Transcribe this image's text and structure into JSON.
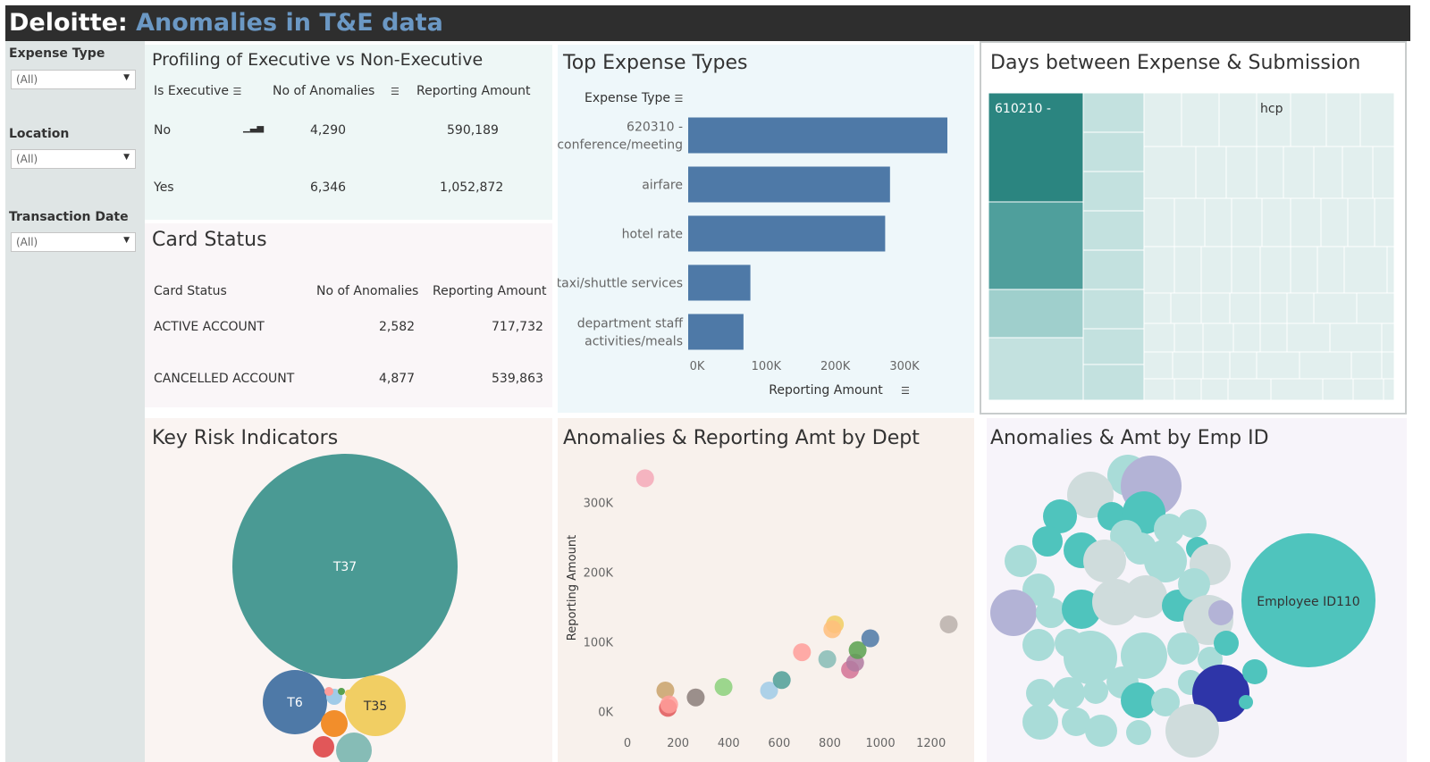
{
  "header": {
    "brand": "Deloitte:",
    "title": "Anomalies in T&E data"
  },
  "filters": [
    {
      "label": "Expense Type",
      "value": "(All)"
    },
    {
      "label": "Location",
      "value": "(All)"
    },
    {
      "label": "Transaction Date",
      "value": "(All)"
    }
  ],
  "profiling": {
    "title": "Profiling of Executive vs Non-Executive",
    "headers": [
      "Is Executive",
      "No of Anomalies",
      "Reporting Amount"
    ],
    "rows": [
      {
        "label": "No",
        "anomalies": "4,290",
        "amount": "590,189"
      },
      {
        "label": "Yes",
        "anomalies": "6,346",
        "amount": "1,052,872"
      }
    ]
  },
  "card_status": {
    "title": "Card Status",
    "headers": [
      "Card Status",
      "No of Anomalies",
      "Reporting Amount"
    ],
    "rows": [
      {
        "label": "ACTIVE ACCOUNT",
        "anomalies": "2,582",
        "amount": "717,732"
      },
      {
        "label": "CANCELLED ACCOUNT",
        "anomalies": "4,877",
        "amount": "539,863"
      }
    ]
  },
  "top_expense": {
    "title": "Top Expense Types",
    "col_header": "Expense Type"
  },
  "days_between": {
    "title": "Days between Expense & Submission",
    "labels": [
      "610210 -",
      "hcp"
    ],
    "colors": {
      "dark": "#2b8580",
      "mid": "#4f9f9c",
      "light": "#9fcfcc",
      "lighter": "#c3e1df",
      "pale": "#e2efee"
    }
  },
  "key_risk": {
    "title": "Key Risk Indicators"
  },
  "dept": {
    "title": "Anomalies & Reporting Amt by Dept"
  },
  "emp": {
    "title": "Anomalies & Amt by Emp ID",
    "highlight_label": "Employee ID110"
  },
  "chart_data": [
    {
      "type": "bar",
      "orientation": "horizontal",
      "title": "Top Expense Types",
      "categories": [
        "620310 - conference/meeting",
        "airfare",
        "hotel rate",
        "taxi/shuttle services",
        "department staff activities/meals"
      ],
      "values": [
        375000,
        292000,
        285000,
        90000,
        80000
      ],
      "xlabel": "Reporting Amount",
      "ylabel": "Expense Type",
      "xlim": [
        0,
        375000
      ],
      "xticks": [
        "0K",
        "100K",
        "200K",
        "300K"
      ],
      "color": "#4e79a7"
    },
    {
      "type": "scatter",
      "title": "Anomalies & Reporting Amt by Dept",
      "ylabel": "Reporting Amount",
      "xlim": [
        0,
        1300
      ],
      "ylim": [
        -15000,
        365000
      ],
      "xticks": [
        "0",
        "200",
        "400",
        "600",
        "800",
        "1000",
        "1200"
      ],
      "yticks": [
        "0K",
        "100K",
        "200K",
        "300K"
      ],
      "points": [
        {
          "x": 70,
          "y": 335000,
          "color": "#f4a9b8"
        },
        {
          "x": 150,
          "y": 30000,
          "color": "#c9a26b"
        },
        {
          "x": 160,
          "y": 5000,
          "color": "#e15759"
        },
        {
          "x": 165,
          "y": 10000,
          "color": "#ff9d9a"
        },
        {
          "x": 270,
          "y": 20000,
          "color": "#8b7e7a"
        },
        {
          "x": 380,
          "y": 35000,
          "color": "#8cd17d"
        },
        {
          "x": 560,
          "y": 30000,
          "color": "#a0cbe8"
        },
        {
          "x": 610,
          "y": 45000,
          "color": "#4e9f98"
        },
        {
          "x": 690,
          "y": 85000,
          "color": "#ff9d9a"
        },
        {
          "x": 790,
          "y": 75000,
          "color": "#86bcb6"
        },
        {
          "x": 820,
          "y": 125000,
          "color": "#f1ce63"
        },
        {
          "x": 810,
          "y": 118000,
          "color": "#ffbe7d"
        },
        {
          "x": 880,
          "y": 60000,
          "color": "#d37295"
        },
        {
          "x": 900,
          "y": 70000,
          "color": "#b07aa1"
        },
        {
          "x": 910,
          "y": 88000,
          "color": "#59a14f"
        },
        {
          "x": 960,
          "y": 105000,
          "color": "#4e79a7"
        },
        {
          "x": 1270,
          "y": 125000,
          "color": "#bab0ac"
        }
      ]
    },
    {
      "type": "bubble",
      "title": "Key Risk Indicators",
      "bubbles": [
        {
          "label": "T37",
          "color": "#4a9a94"
        },
        {
          "label": "T6",
          "color": "#4e79a7"
        },
        {
          "label": "T35",
          "color": "#f1ce63"
        },
        {
          "label": "",
          "color": "#f28e2b"
        },
        {
          "label": "",
          "color": "#a0cbe8"
        },
        {
          "label": "",
          "color": "#e15759"
        },
        {
          "label": "",
          "color": "#86bcb6"
        },
        {
          "label": "",
          "color": "#ff9d9a"
        },
        {
          "label": "",
          "color": "#59a14f"
        },
        {
          "label": "",
          "color": "#f1ce63"
        }
      ]
    }
  ]
}
